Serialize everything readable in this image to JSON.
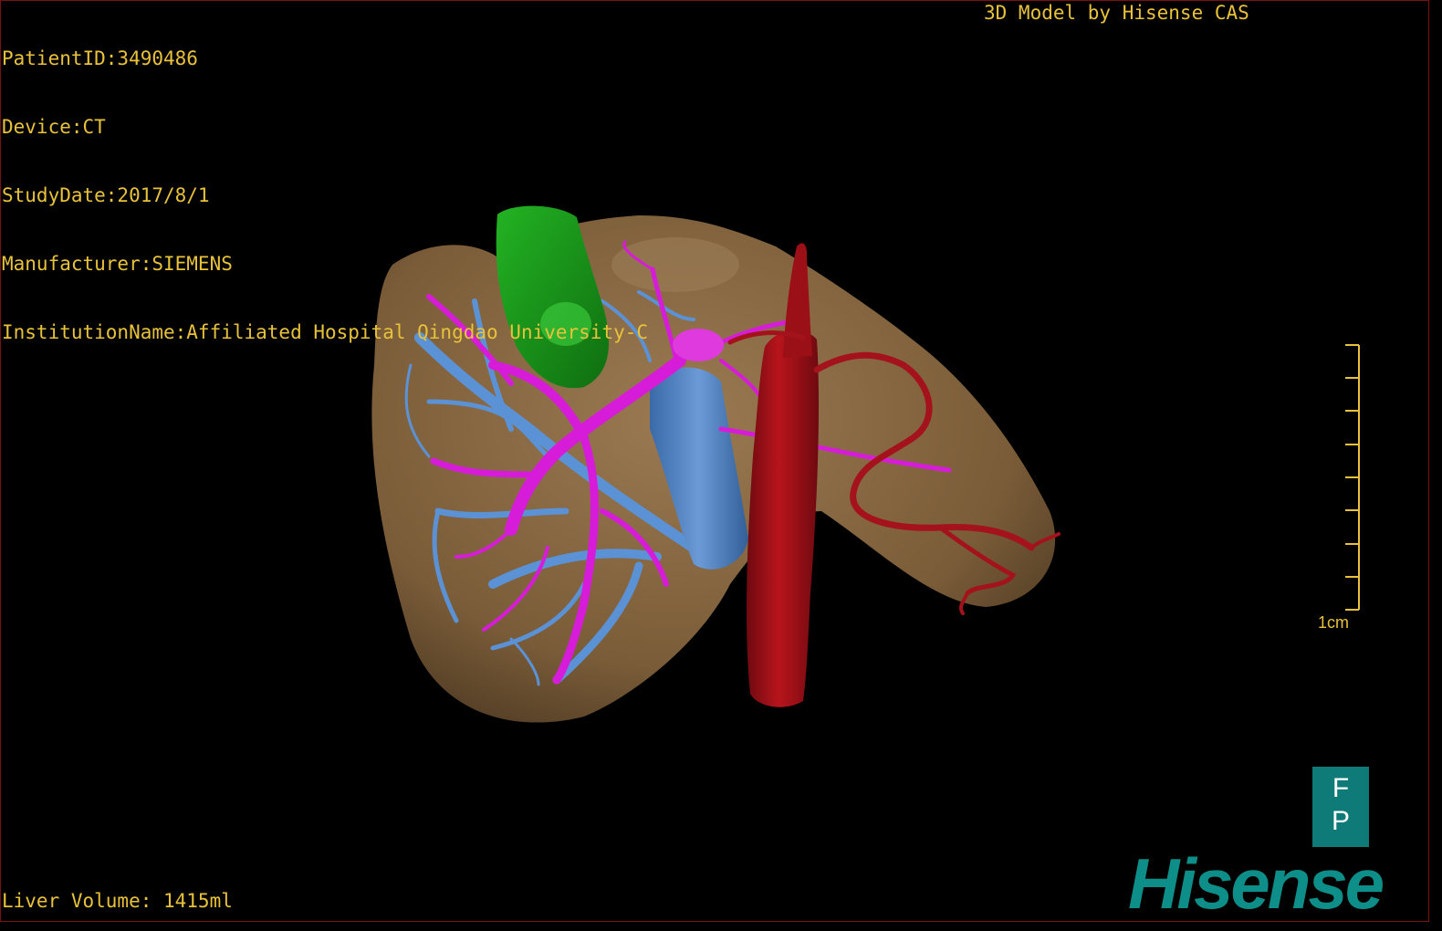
{
  "header": {
    "patient_id": "PatientID:3490486",
    "device": "Device:CT",
    "study_date": "StudyDate:2017/8/1",
    "manufacturer": "Manufacturer:SIEMENS",
    "institution": "InstitutionName:Affiliated Hospital Qingdao University-C"
  },
  "brand_caption": "3D Model by Hisense CAS",
  "footer": {
    "liver_volume": "Liver Volume: 1415ml"
  },
  "scale_bar": {
    "label": "1cm",
    "ticks": 9
  },
  "orientation_cube": {
    "top": "F",
    "bottom": "P"
  },
  "logo_text": "Hisense",
  "colors": {
    "text": "#e8c23a",
    "liver": "#8a6a43",
    "gallbladder": "#1fa41f",
    "portal_vein": "#d01ad6",
    "hepatic_vein": "#4f86c8",
    "aorta": "#a8121a",
    "brand": "#0e8e88"
  }
}
